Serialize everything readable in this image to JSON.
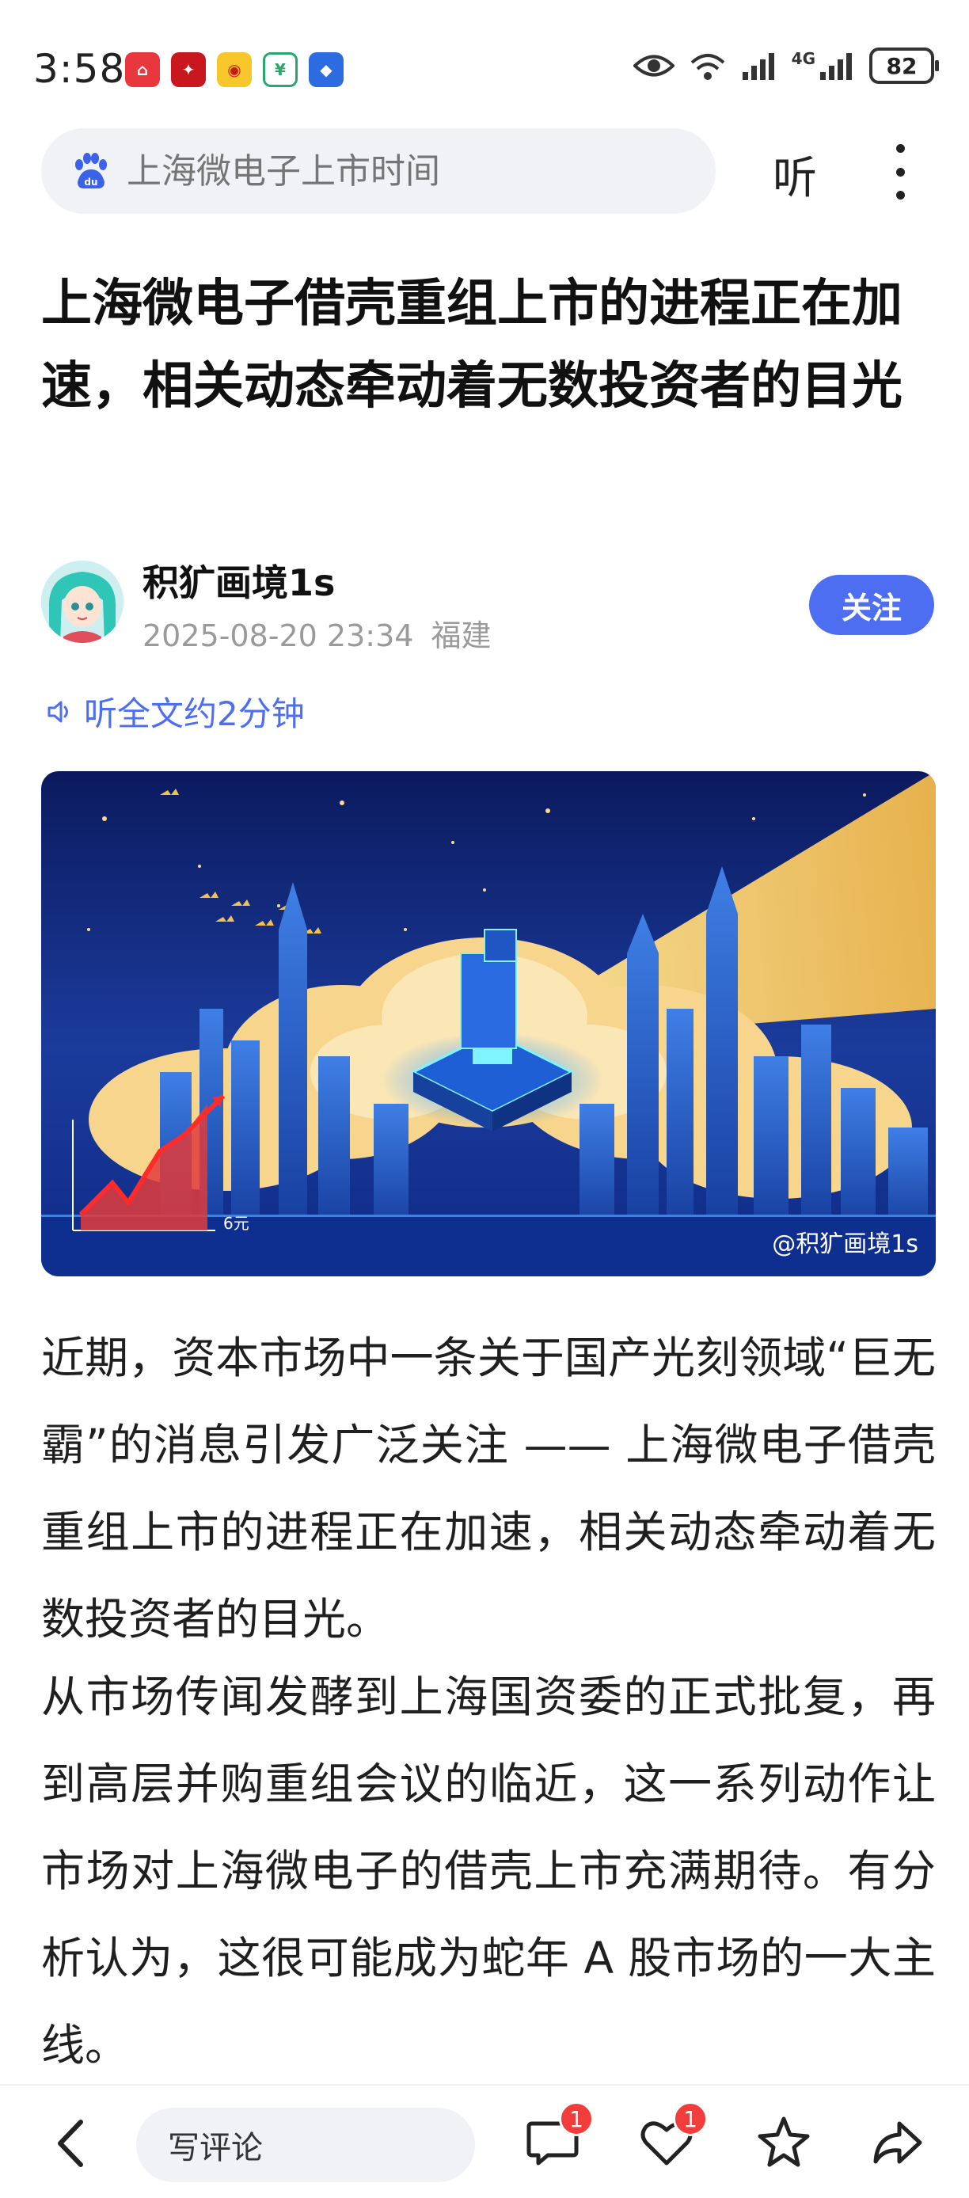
{
  "status": {
    "time": "3:58",
    "battery": "82",
    "network_label": "4G"
  },
  "search": {
    "placeholder": "上海微电子上市时间",
    "listen_label": "听"
  },
  "article": {
    "title": "上海微电子借壳重组上市的进程正在加速，相关动态牵动着无数投资者的目光",
    "listen_full": "听全文约2分钟",
    "paragraphs": [
      "近期，资本市场中一条关于国产光刻领域“巨无霸”的消息引发广泛关注 —— 上海微电子借壳重组上市的进程正在加速，相关动态牵动着无数投资者的目光。",
      "从市场传闻发酵到上海国资委的正式批复，再到高层并购重组会议的临近，这一系列动作让市场对上海微电子的借壳上市充满期待。有分析认为，这很可能成为蛇年 A 股市场的一大主线。"
    ]
  },
  "author": {
    "name": "积犷画境1s",
    "date": "2025-08-20 23:34",
    "location": "福建",
    "follow_label": "关注"
  },
  "hero": {
    "watermark": "@积犷画境1s",
    "chart_label": "6元"
  },
  "toolbar": {
    "comment_placeholder": "写评论",
    "comment_count": "1",
    "like_count": "1"
  },
  "colors": {
    "accent": "#4e6ef2",
    "badge": "#f23d3d"
  }
}
